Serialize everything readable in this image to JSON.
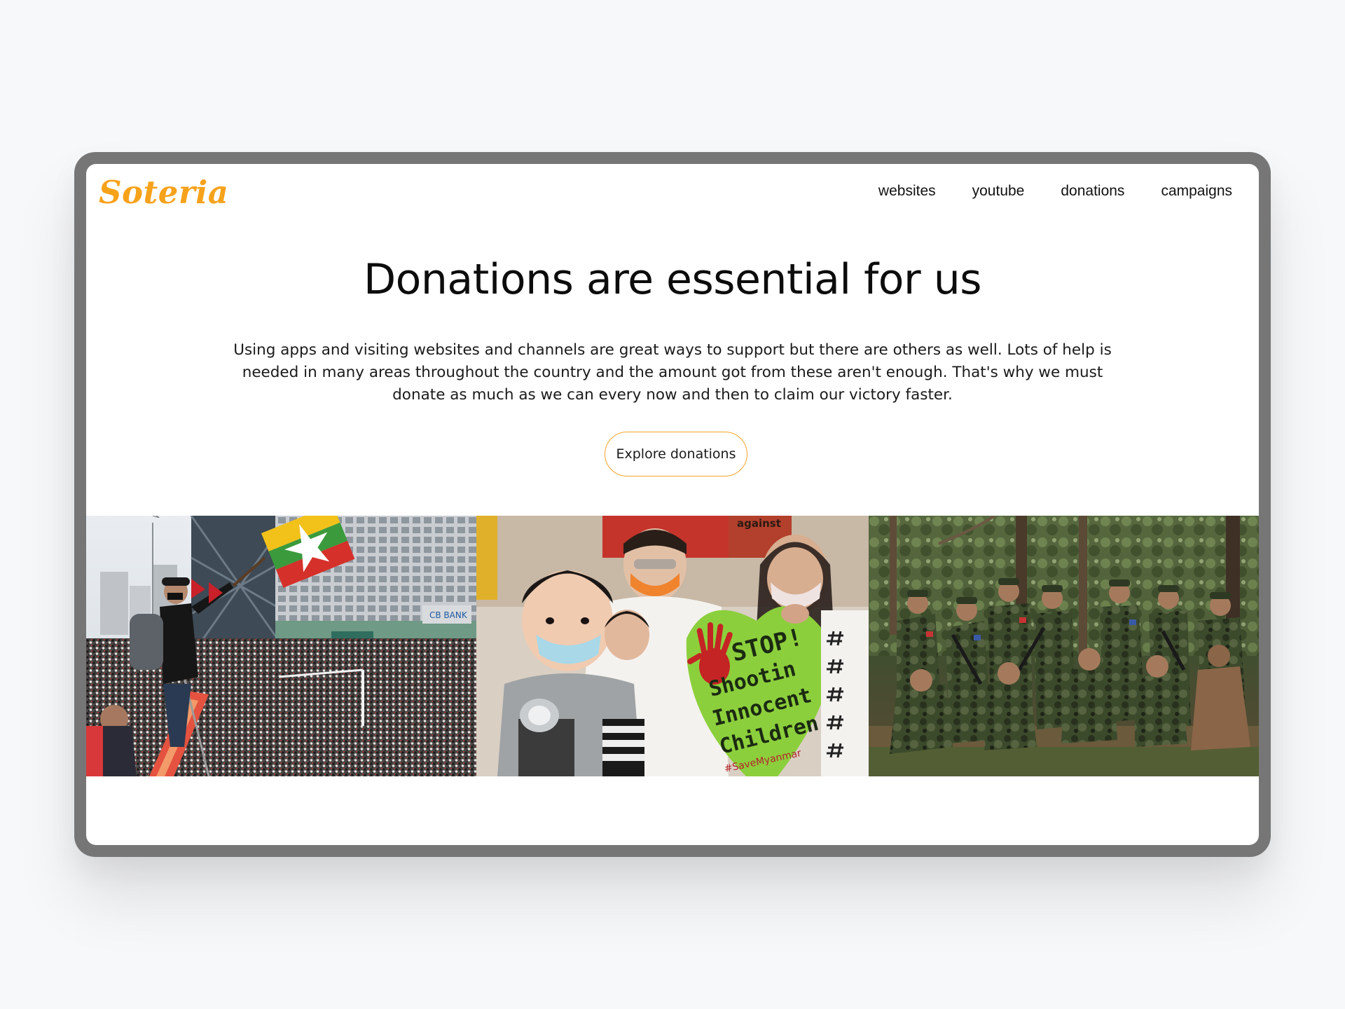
{
  "brand": {
    "name": "Soteria",
    "color": "#f7a21b"
  },
  "nav": {
    "items": [
      {
        "label": "websites"
      },
      {
        "label": "youtube"
      },
      {
        "label": "donations"
      },
      {
        "label": "campaigns"
      }
    ]
  },
  "hero": {
    "title": "Donations are essential for us",
    "body": "Using apps and visiting websites and channels are great ways to support but there are others as well. Lots of help is needed in many areas throughout the country and the amount got from these aren't enough. That's why we must donate as much as we can every now and then to claim our victory faster.",
    "cta_label": "Explore donations",
    "cta_border_color": "#f2a32a"
  },
  "gallery": {
    "photo2_sign": {
      "line1": "STOP!",
      "line2": "Shootin",
      "line3": "Innocent",
      "line4": "Children",
      "tag": "#SaveMyanmar"
    },
    "photo2_banner": "against",
    "photo1_storefront": "CB BANK"
  }
}
